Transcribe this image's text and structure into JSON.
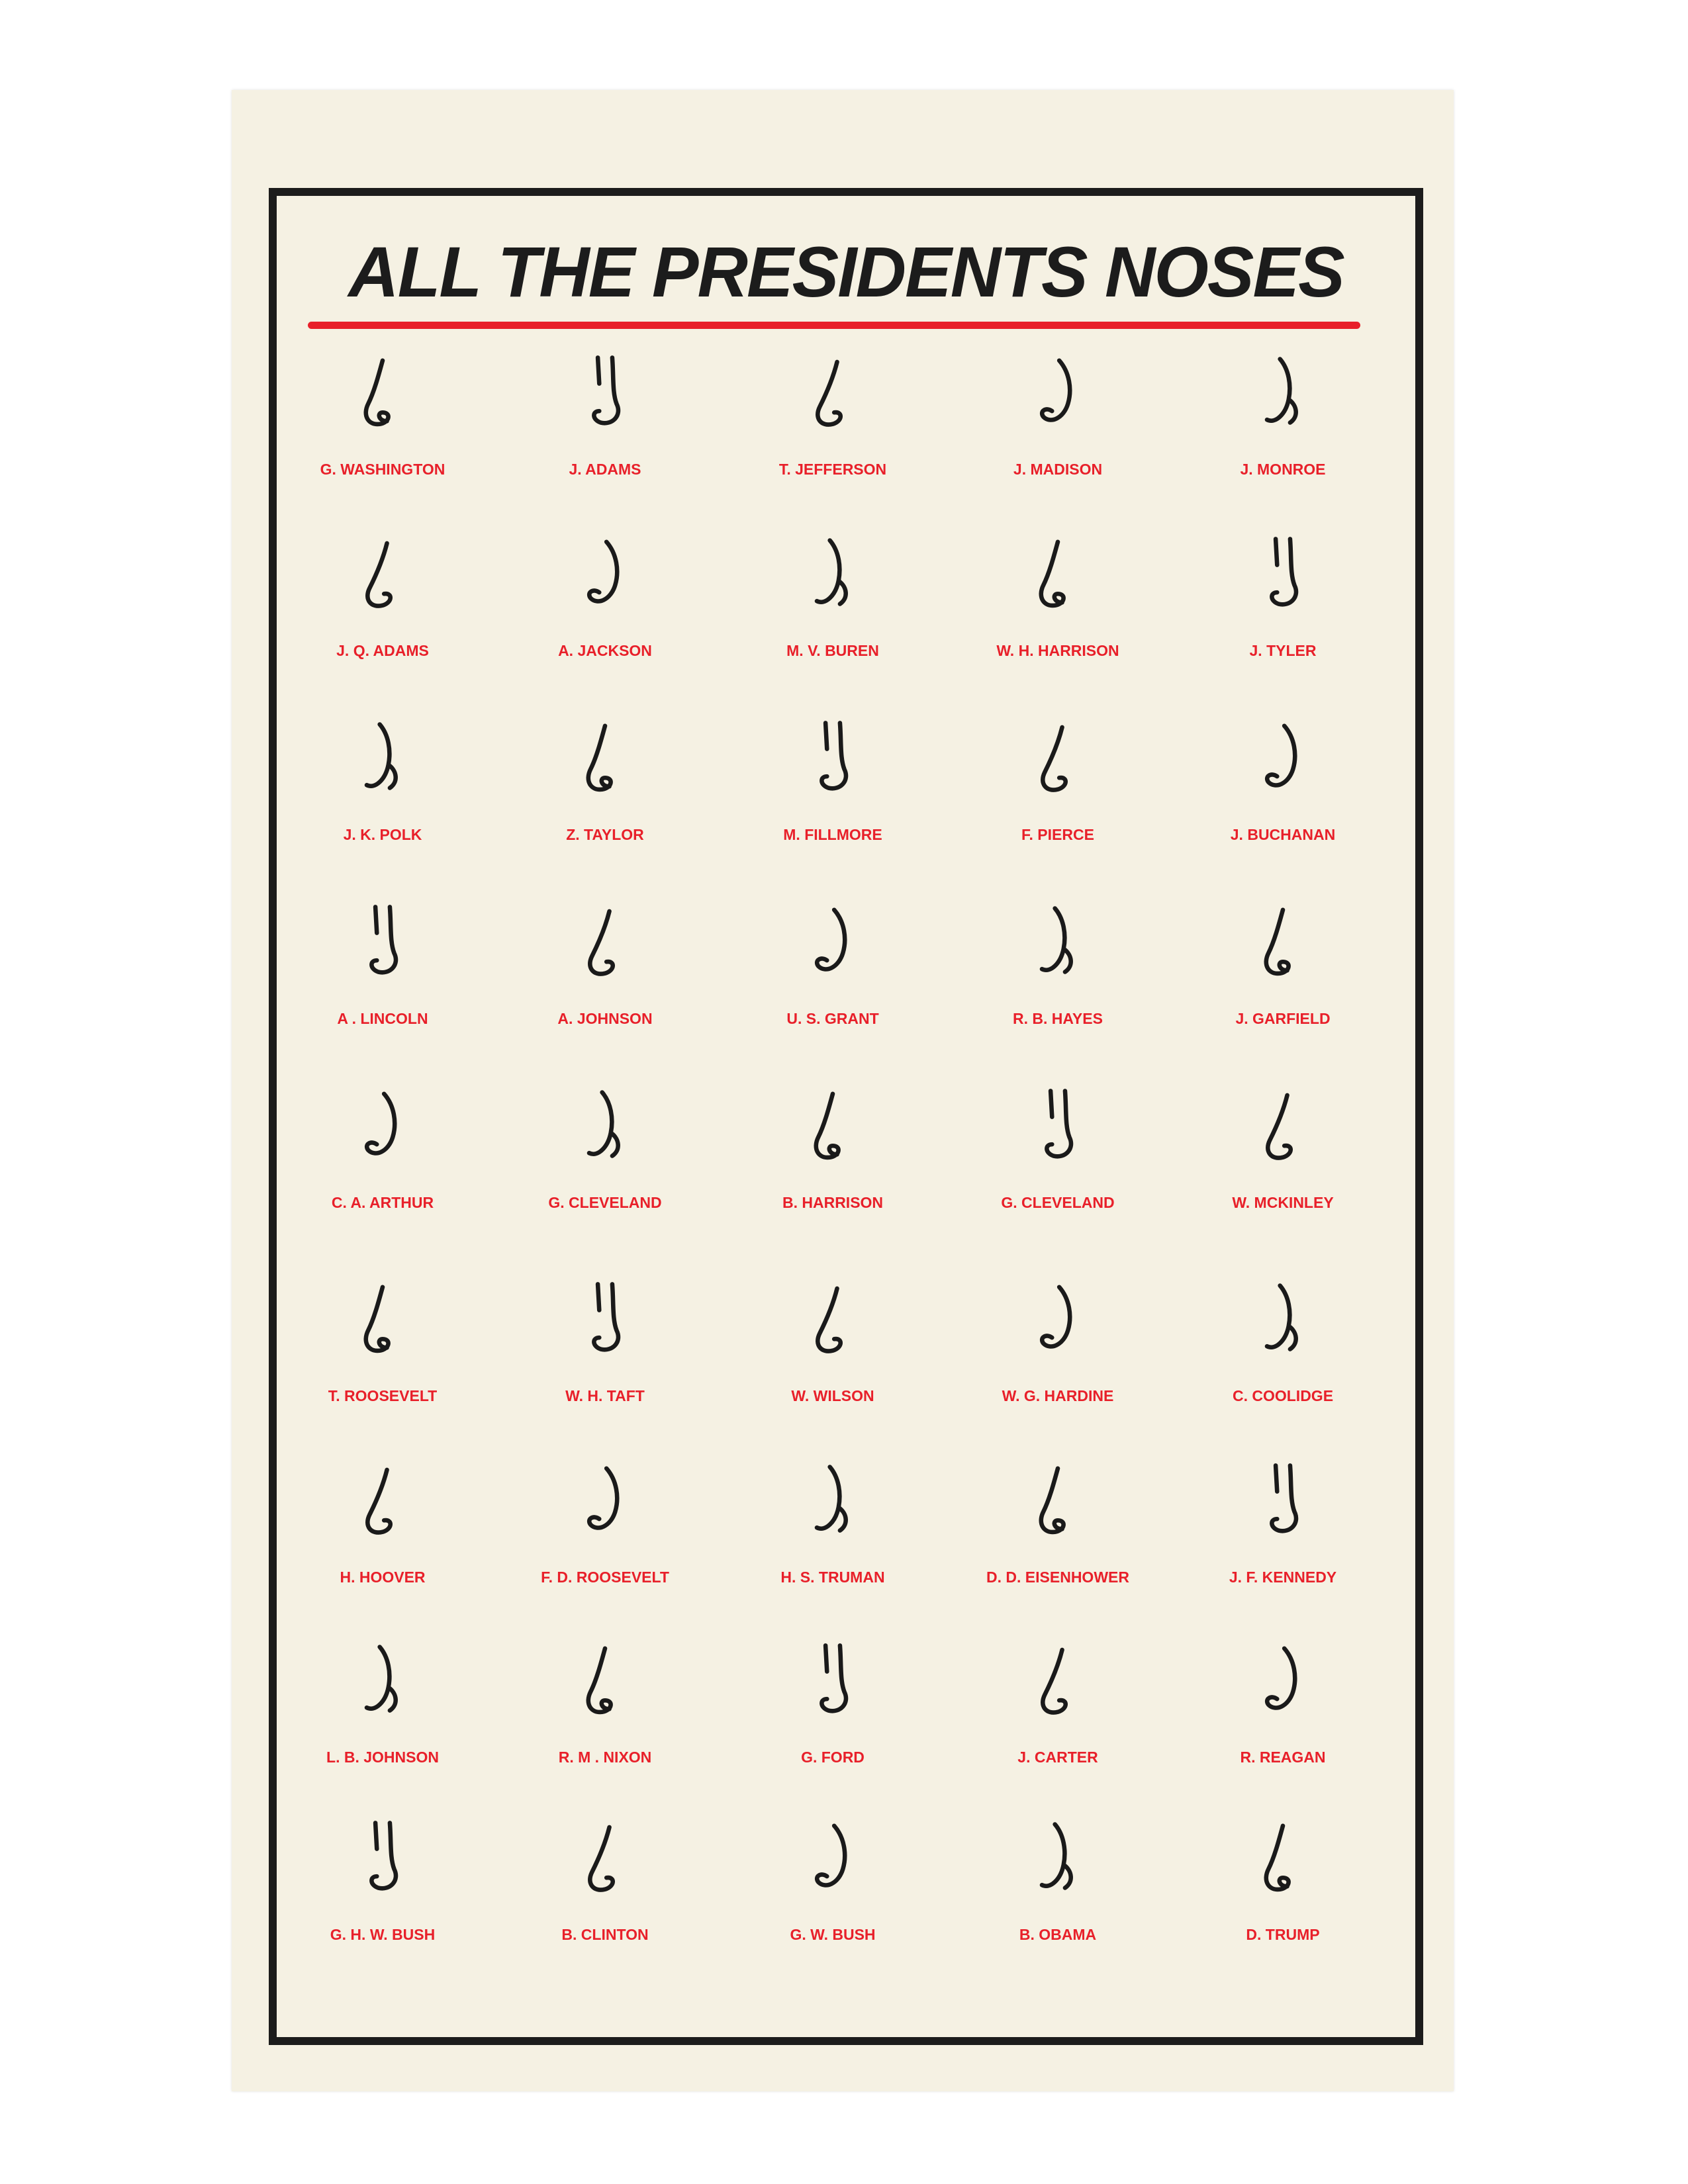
{
  "poster": {
    "title": "ALL THE PRESIDENTS NOSES",
    "colors": {
      "background": "#f5f1e3",
      "frame": "#1c1c1c",
      "accent": "#e8202a",
      "ink": "#1a1a1a"
    },
    "nose_icon": "nose-line-drawing",
    "presidents": [
      "G. WASHINGTON",
      "J. ADAMS",
      "T. JEFFERSON",
      "J. MADISON",
      "J. MONROE",
      "J. Q. ADAMS",
      "A. JACKSON",
      "M. V. BUREN",
      "W. H. HARRISON",
      "J. TYLER",
      "J. K. POLK",
      "Z. TAYLOR",
      "M. FILLMORE",
      "F. PIERCE",
      "J. BUCHANAN",
      "A . LINCOLN",
      "A. JOHNSON",
      "U. S. GRANT",
      "R. B. HAYES",
      "J. GARFIELD",
      "C. A. ARTHUR",
      "G. CLEVELAND",
      "B. HARRISON",
      "G. CLEVELAND",
      "W. MCKINLEY",
      "T. ROOSEVELT",
      "W. H. TAFT",
      "W. WILSON",
      "W. G. HARDINE",
      "C. COOLIDGE",
      "H. HOOVER",
      "F. D. ROOSEVELT",
      "H. S. TRUMAN",
      "D. D. EISENHOWER",
      "J. F. KENNEDY",
      "L. B. JOHNSON",
      "R. M . NIXON",
      "G. FORD",
      "J. CARTER",
      "R. REAGAN",
      "G. H. W. BUSH",
      "B. CLINTON",
      "G. W. BUSH",
      "B. OBAMA",
      "D. TRUMP"
    ]
  }
}
